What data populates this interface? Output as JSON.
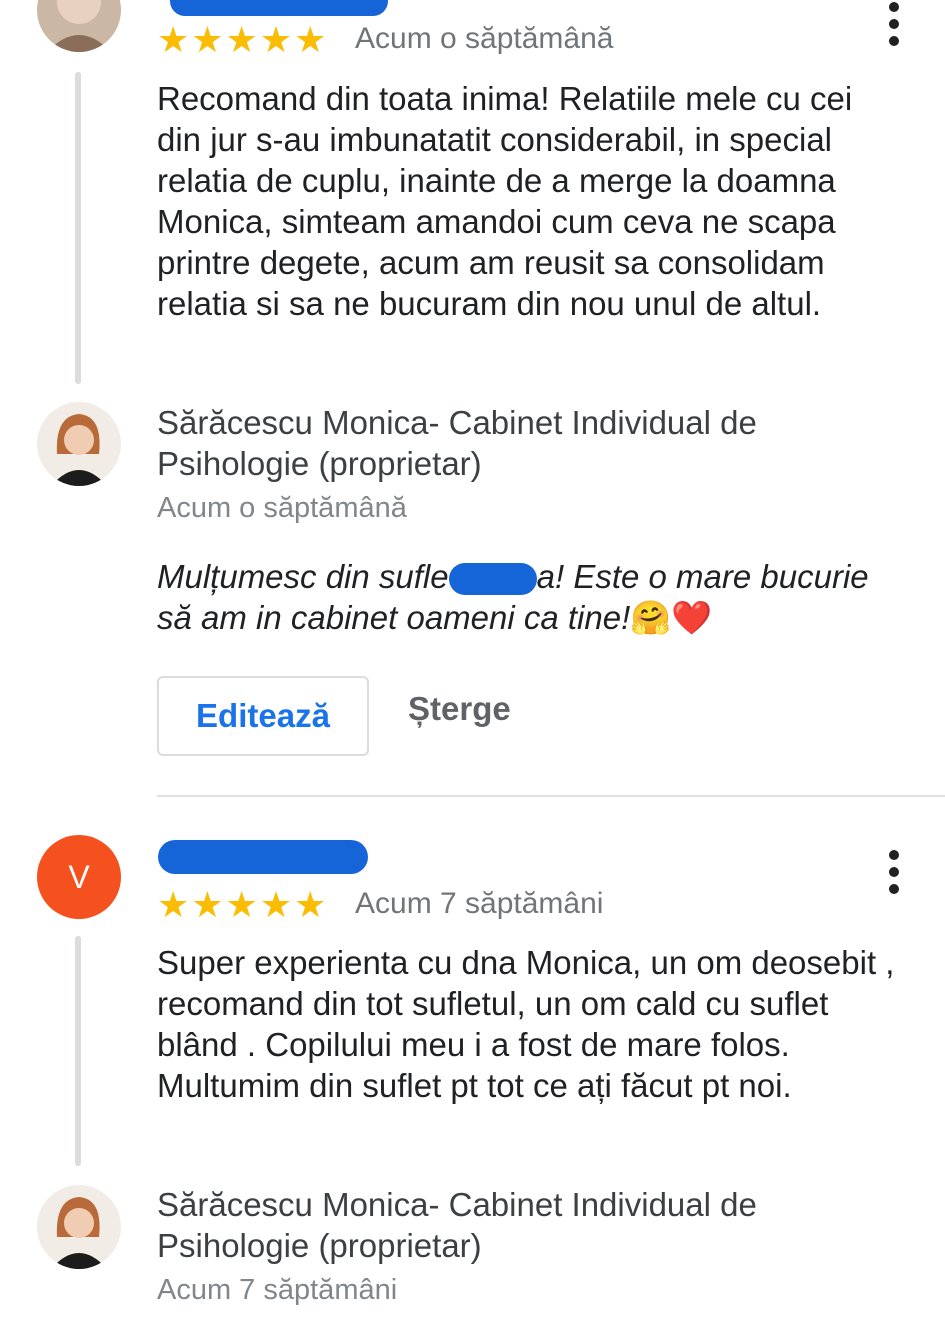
{
  "review1": {
    "rating_stars": "★★★★★",
    "rating": 5,
    "time": "Acum o săptămână",
    "text": "Recomand din toata inima! Relatiile mele cu cei din jur s-au imbunatatit considerabil, in special relatia de cuplu, inainte de a merge la doamna Monica, simteam amandoi cum ceva ne scapa printre degete, acum am reusit sa consolidam relatia si sa ne bucuram din nou unul de altul.",
    "owner_reply": {
      "name": "Sărăcescu Monica- Cabinet Individual de Psihologie (proprietar)",
      "time": "Acum o săptămână",
      "text_before": "Mulțumesc din sufle",
      "text_after": "a! Este o mare bucurie să am in cabinet oameni ca tine!",
      "emoji": "🤗❤️"
    },
    "actions": {
      "edit": "Editează",
      "delete": "Șterge"
    }
  },
  "review2": {
    "avatar_letter": "V",
    "rating_stars": "★★★★★",
    "rating": 5,
    "time": "Acum 7 săptămâni",
    "text": "Super experienta cu dna Monica, un om deosebit , recomand din tot sufletul, un om cald cu suflet blând . Copilului meu i a fost de mare folos. Multumim din suflet pt tot ce ați făcut pt noi.",
    "owner_reply": {
      "name": "Sărăcescu Monica- Cabinet Individual de Psihologie (proprietar)",
      "time": "Acum 7 săptămâni"
    }
  },
  "colors": {
    "star": "#fbbc04",
    "accent_blue": "#1a73e8",
    "avatar_v": "#f4511e",
    "redaction": "#1565d8"
  }
}
